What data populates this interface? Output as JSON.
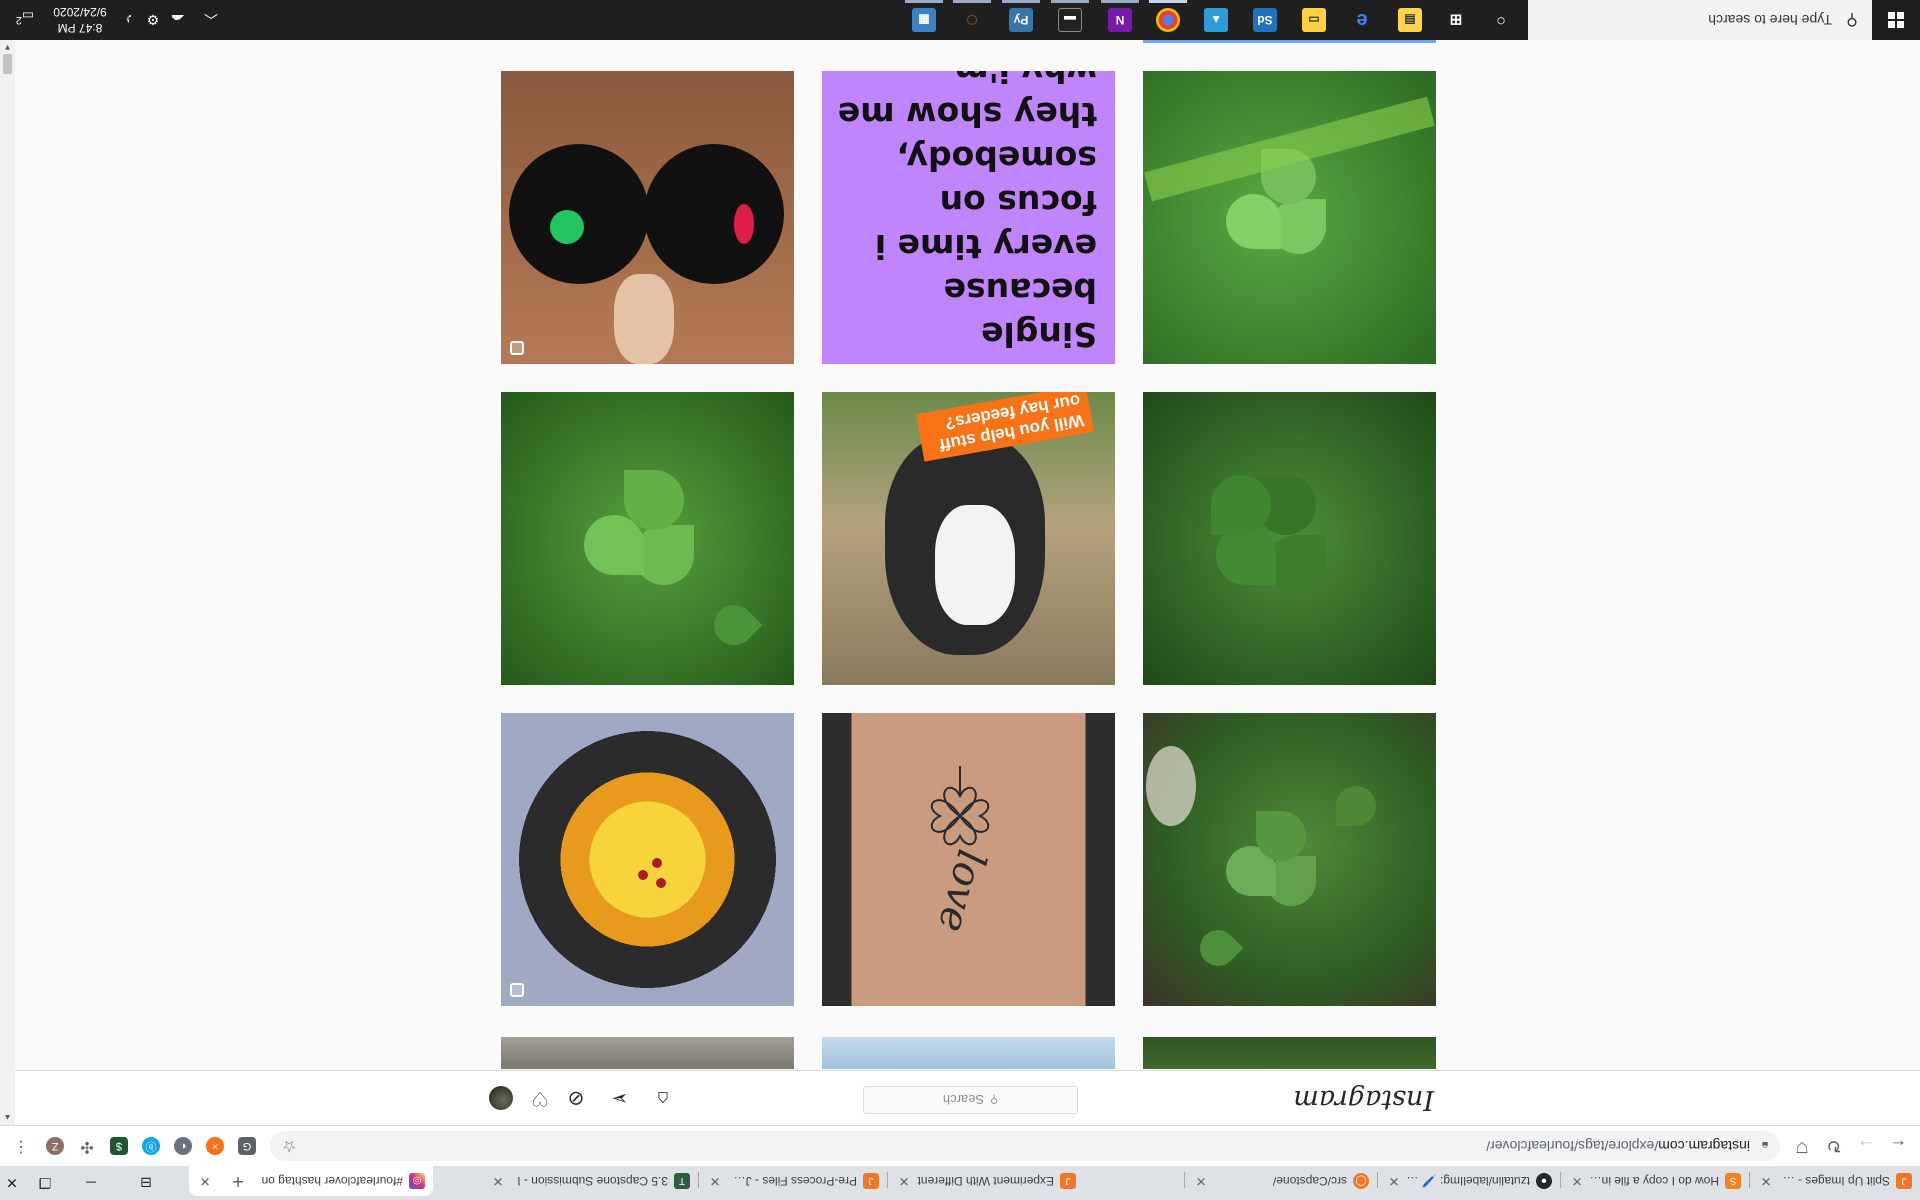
{
  "tabs": [
    {
      "title": "Split Up Images - Jupyter N",
      "active": false
    },
    {
      "title": "How do I copy a file in Pyth",
      "active": false
    },
    {
      "title": "tzutalin/labelImg: 🖊️ Label",
      "active": false
    },
    {
      "title": "src/Capstone/",
      "active": false
    },
    {
      "title": "Experiment With Different",
      "active": false
    },
    {
      "title": "Pre-Process Files - Jupyter",
      "active": false
    },
    {
      "title": "3.5 Capstone Submission - I",
      "active": false
    },
    {
      "title": "#fourleafclover hashtag on",
      "active": true
    }
  ],
  "toolbar": {
    "url_host": "instagram.com",
    "url_path": "/explore/tags/fourleafclover/"
  },
  "instagram": {
    "logo": "Instagram",
    "search_placeholder": "Search"
  },
  "posts": [
    {
      "alt": "clover meadow",
      "multi": false
    },
    {
      "alt": "tattoo",
      "multi": false
    },
    {
      "alt": "cake",
      "multi": true
    },
    {
      "alt": "clover leaves",
      "multi": false
    },
    {
      "alt": "goat",
      "multi": false
    },
    {
      "alt": "clover patch",
      "multi": false
    },
    {
      "alt": "clover close-up",
      "multi": false
    },
    {
      "alt": "text post",
      "multi": false
    },
    {
      "alt": "hats",
      "multi": true
    }
  ],
  "text_post": "Single because every time i focus on somebody, they show me why i'm better off alone",
  "story_sticker": "Will you help stuff our hay feeders?",
  "tattoo_text": "love",
  "taskbar": {
    "search_placeholder": "Type here to search",
    "time": "8:47 PM",
    "date": "9/24/2020",
    "notification_count": "2"
  }
}
